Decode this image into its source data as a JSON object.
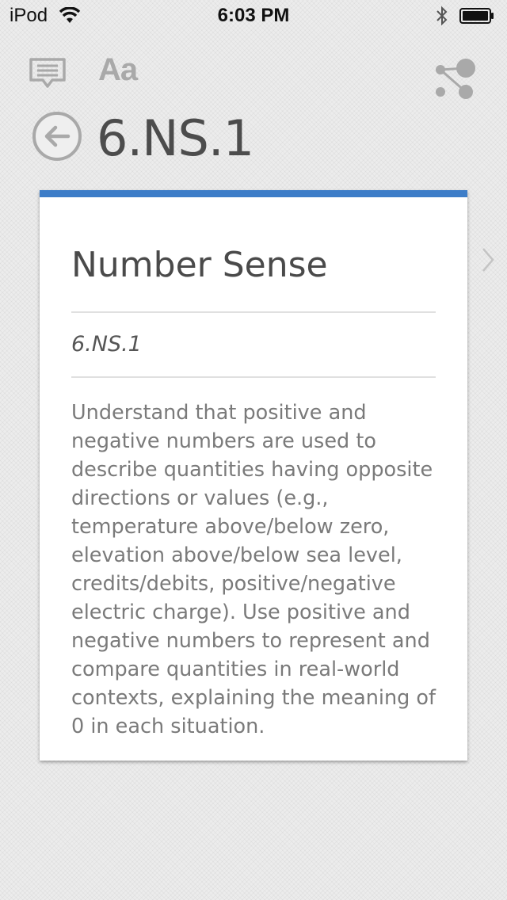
{
  "status_bar": {
    "carrier": "iPod",
    "time": "6:03 PM"
  },
  "toolbar": {
    "font_label": "Aa",
    "icons": [
      "comments-icon",
      "font-size-icon",
      "share-icon"
    ]
  },
  "header": {
    "title": "6.NS.1"
  },
  "card": {
    "title": "Number Sense",
    "code": "6.NS.1",
    "description": "Understand that positive and negative numbers are used to describe quantities having opposite directions or values (e.g., temperature above/below zero, elevation above/below sea level, credits/debits, positive/negative electric charge). Use positive and negative numbers to represent and compare quantities in real-world contexts, explaining the meaning of 0 in each situation.",
    "accent_color": "#3d7dc8"
  }
}
